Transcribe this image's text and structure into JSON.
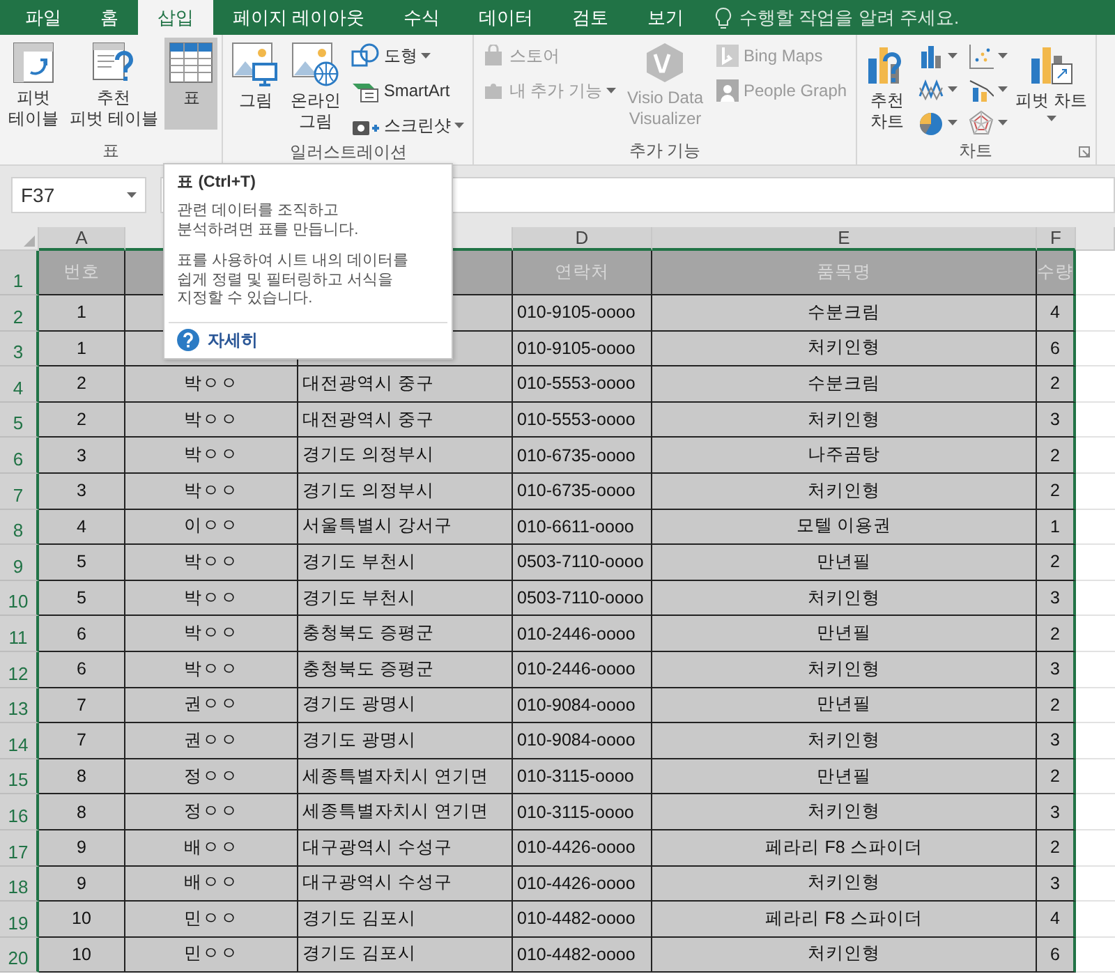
{
  "tabs": [
    {
      "label": "파일",
      "selected": false
    },
    {
      "label": "홈",
      "selected": false
    },
    {
      "label": "삽입",
      "selected": true
    },
    {
      "label": "페이지 레이아웃",
      "selected": false
    },
    {
      "label": "수식",
      "selected": false
    },
    {
      "label": "데이터",
      "selected": false
    },
    {
      "label": "검토",
      "selected": false
    },
    {
      "label": "보기",
      "selected": false
    }
  ],
  "tell_me": {
    "placeholder": "수행할 작업을 알려 주세요."
  },
  "ribbon_groups": [
    {
      "label": "표",
      "items": [
        {
          "kind": "large",
          "lines": [
            "피벗",
            "테이블"
          ],
          "selected": false,
          "disabled": false
        },
        {
          "kind": "large",
          "lines": [
            "추천",
            "피벗 테이블"
          ],
          "selected": false,
          "disabled": false
        },
        {
          "kind": "large",
          "lines": [
            "표"
          ],
          "selected": true,
          "disabled": false
        }
      ]
    },
    {
      "label": "일러스트레이션",
      "items": [
        {
          "kind": "large",
          "lines": [
            "그림"
          ],
          "selected": false,
          "disabled": false
        },
        {
          "kind": "large",
          "lines": [
            "온라인",
            "그림"
          ],
          "selected": false,
          "disabled": false
        },
        {
          "kind": "stack",
          "items": [
            {
              "label": "도형",
              "disabled": false,
              "dropdown": true
            },
            {
              "label": "SmartArt",
              "disabled": false,
              "dropdown": false
            },
            {
              "label": "스크린샷",
              "disabled": false,
              "dropdown": true
            }
          ]
        }
      ]
    },
    {
      "label": "추가 기능",
      "items": [
        {
          "kind": "stack",
          "items": [
            {
              "label": "스토어",
              "disabled": true,
              "dropdown": false
            },
            {
              "label": "내 추가 기능",
              "disabled": true,
              "dropdown": true
            }
          ]
        },
        {
          "kind": "large",
          "lines": [
            "Visio Data",
            "Visualizer"
          ],
          "selected": false,
          "disabled": true
        },
        {
          "kind": "stack",
          "items": [
            {
              "label": "Bing Maps",
              "disabled": true,
              "dropdown": false
            },
            {
              "label": "People Graph",
              "disabled": true,
              "dropdown": false
            }
          ]
        }
      ]
    },
    {
      "label": "차트",
      "launcher": true,
      "items": [
        {
          "kind": "large",
          "lines": [
            "추천",
            "차트"
          ],
          "selected": false,
          "disabled": false
        },
        {
          "kind": "chart-grid"
        },
        {
          "kind": "large",
          "lines": [
            "피벗 차트"
          ],
          "selected": false,
          "disabled": false,
          "dropdown": true
        }
      ]
    }
  ],
  "name_box": {
    "value": "F37"
  },
  "column_letters": [
    "A",
    "D",
    "E",
    "F"
  ],
  "header_row": {
    "row": "1",
    "no": "번호",
    "phone": "연락처",
    "item": "품목명",
    "qty": "수량"
  },
  "rows": [
    {
      "row": "2",
      "no": "1",
      "phone": "010-9105-oooo",
      "item": "수분크림",
      "qty": "4"
    },
    {
      "row": "3",
      "no": "1",
      "phone": "010-9105-oooo",
      "item": "처키인형",
      "qty": "6"
    },
    {
      "row": "4",
      "no": "2",
      "name": "박ㅇㅇ",
      "address": "대전광역시 중구",
      "phone": "010-5553-oooo",
      "item": "수분크림",
      "qty": "2"
    },
    {
      "row": "5",
      "no": "2",
      "name": "박ㅇㅇ",
      "address": "대전광역시 중구",
      "phone": "010-5553-oooo",
      "item": "처키인형",
      "qty": "3"
    },
    {
      "row": "6",
      "no": "3",
      "name": "박ㅇㅇ",
      "address": "경기도 의정부시",
      "phone": "010-6735-oooo",
      "item": "나주곰탕",
      "qty": "2"
    },
    {
      "row": "7",
      "no": "3",
      "name": "박ㅇㅇ",
      "address": "경기도 의정부시",
      "phone": "010-6735-oooo",
      "item": "처키인형",
      "qty": "2"
    },
    {
      "row": "8",
      "no": "4",
      "name": "이ㅇㅇ",
      "address": "서울특별시 강서구",
      "phone": "010-6611-oooo",
      "item": "모텔 이용권",
      "qty": "1"
    },
    {
      "row": "9",
      "no": "5",
      "name": "박ㅇㅇ",
      "address": "경기도 부천시",
      "phone": "0503-7110-oooo",
      "item": "만년필",
      "qty": "2"
    },
    {
      "row": "10",
      "no": "5",
      "name": "박ㅇㅇ",
      "address": "경기도 부천시",
      "phone": "0503-7110-oooo",
      "item": "처키인형",
      "qty": "3"
    },
    {
      "row": "11",
      "no": "6",
      "name": "박ㅇㅇ",
      "address": "충청북도 증평군",
      "phone": "010-2446-oooo",
      "item": "만년필",
      "qty": "2"
    },
    {
      "row": "12",
      "no": "6",
      "name": "박ㅇㅇ",
      "address": "충청북도 증평군",
      "phone": "010-2446-oooo",
      "item": "처키인형",
      "qty": "3"
    },
    {
      "row": "13",
      "no": "7",
      "name": "권ㅇㅇ",
      "address": "경기도 광명시",
      "phone": "010-9084-oooo",
      "item": "만년필",
      "qty": "2"
    },
    {
      "row": "14",
      "no": "7",
      "name": "권ㅇㅇ",
      "address": "경기도 광명시",
      "phone": "010-9084-oooo",
      "item": "처키인형",
      "qty": "3"
    },
    {
      "row": "15",
      "no": "8",
      "name": "정ㅇㅇ",
      "address": "세종특별자치시 연기면",
      "phone": "010-3115-oooo",
      "item": "만년필",
      "qty": "2"
    },
    {
      "row": "16",
      "no": "8",
      "name": "정ㅇㅇ",
      "address": "세종특별자치시 연기면",
      "phone": "010-3115-oooo",
      "item": "처키인형",
      "qty": "3"
    },
    {
      "row": "17",
      "no": "9",
      "name": "배ㅇㅇ",
      "address": "대구광역시 수성구",
      "phone": "010-4426-oooo",
      "item": "페라리 F8 스파이더",
      "qty": "2"
    },
    {
      "row": "18",
      "no": "9",
      "name": "배ㅇㅇ",
      "address": "대구광역시 수성구",
      "phone": "010-4426-oooo",
      "item": "처키인형",
      "qty": "3"
    },
    {
      "row": "19",
      "no": "10",
      "name": "민ㅇㅇ",
      "address": "경기도 김포시",
      "phone": "010-4482-oooo",
      "item": "페라리 F8 스파이더",
      "qty": "4"
    },
    {
      "row": "20",
      "no": "10",
      "name": "민ㅇㅇ",
      "address": "경기도 김포시",
      "phone": "010-4482-oooo",
      "item": "처키인형",
      "qty": "6"
    }
  ],
  "tooltip": {
    "title": "표 (Ctrl+T)",
    "paragraphs": [
      "관련 데이터를 조직하고\n분석하려면 표를 만듭니다.",
      "표를 사용하여 시트 내의 데이터를\n쉽게 정렬 및 필터링하고 서식을\n지정할 수 있습니다."
    ],
    "link": "자세히"
  }
}
